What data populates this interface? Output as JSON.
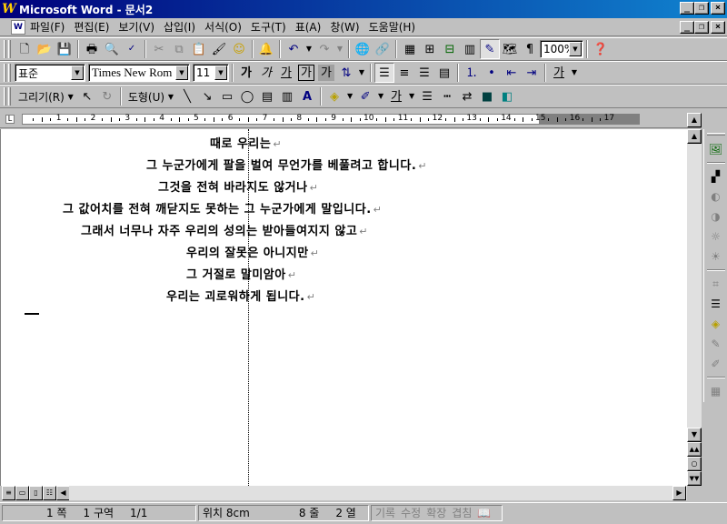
{
  "window": {
    "title": "Microsoft Word - 문서2",
    "app_icon_letter": "W"
  },
  "menu": [
    "파일(F)",
    "편집(E)",
    "보기(V)",
    "삽입(I)",
    "서식(O)",
    "도구(T)",
    "표(A)",
    "창(W)",
    "도움말(H)"
  ],
  "standard_toolbar": {
    "zoom_value": "100%"
  },
  "formatting_toolbar": {
    "style_value": "표준",
    "font_value": "Times New Rom",
    "size_value": "11",
    "bold_label": "가",
    "italic_label": "가",
    "underline_label": "가",
    "outline_label": "가",
    "shade_label": "가",
    "char_color_label": "가"
  },
  "drawing_toolbar": {
    "draw_label": "그리기(R)",
    "autoshapes_label": "도형(U)"
  },
  "ruler": {
    "numbers": [
      "1",
      "2",
      "3",
      "4",
      "5",
      "6",
      "7",
      "8",
      "9",
      "10",
      "11",
      "12",
      "13",
      "14",
      "15",
      "16",
      "17"
    ]
  },
  "document": {
    "lines": [
      "때로 우리는",
      "그 누군가에게 팔을 벌여 무언가를 베풀려고 합니다.",
      "그것을 전혀 바라지도 않거나",
      "그 값어치를 전혀 깨닫지도 못하는 그 누군가에게 말입니다.",
      "그래서 너무나 자주 우리의 성의는 받아들여지지 않고",
      "우리의 잘못은 아니지만",
      "그 거절로 말미암아",
      "우리는 괴로워하게 됩니다."
    ],
    "paragraph_mark": "↵"
  },
  "status": {
    "page": "1 쪽",
    "section": "1 구역",
    "page_of": "1/1",
    "position": "위치 8cm",
    "line": "8 줄",
    "column": "2 열",
    "rec": "기록",
    "trk": "수정",
    "ext": "확장",
    "ovr": "겹침"
  }
}
